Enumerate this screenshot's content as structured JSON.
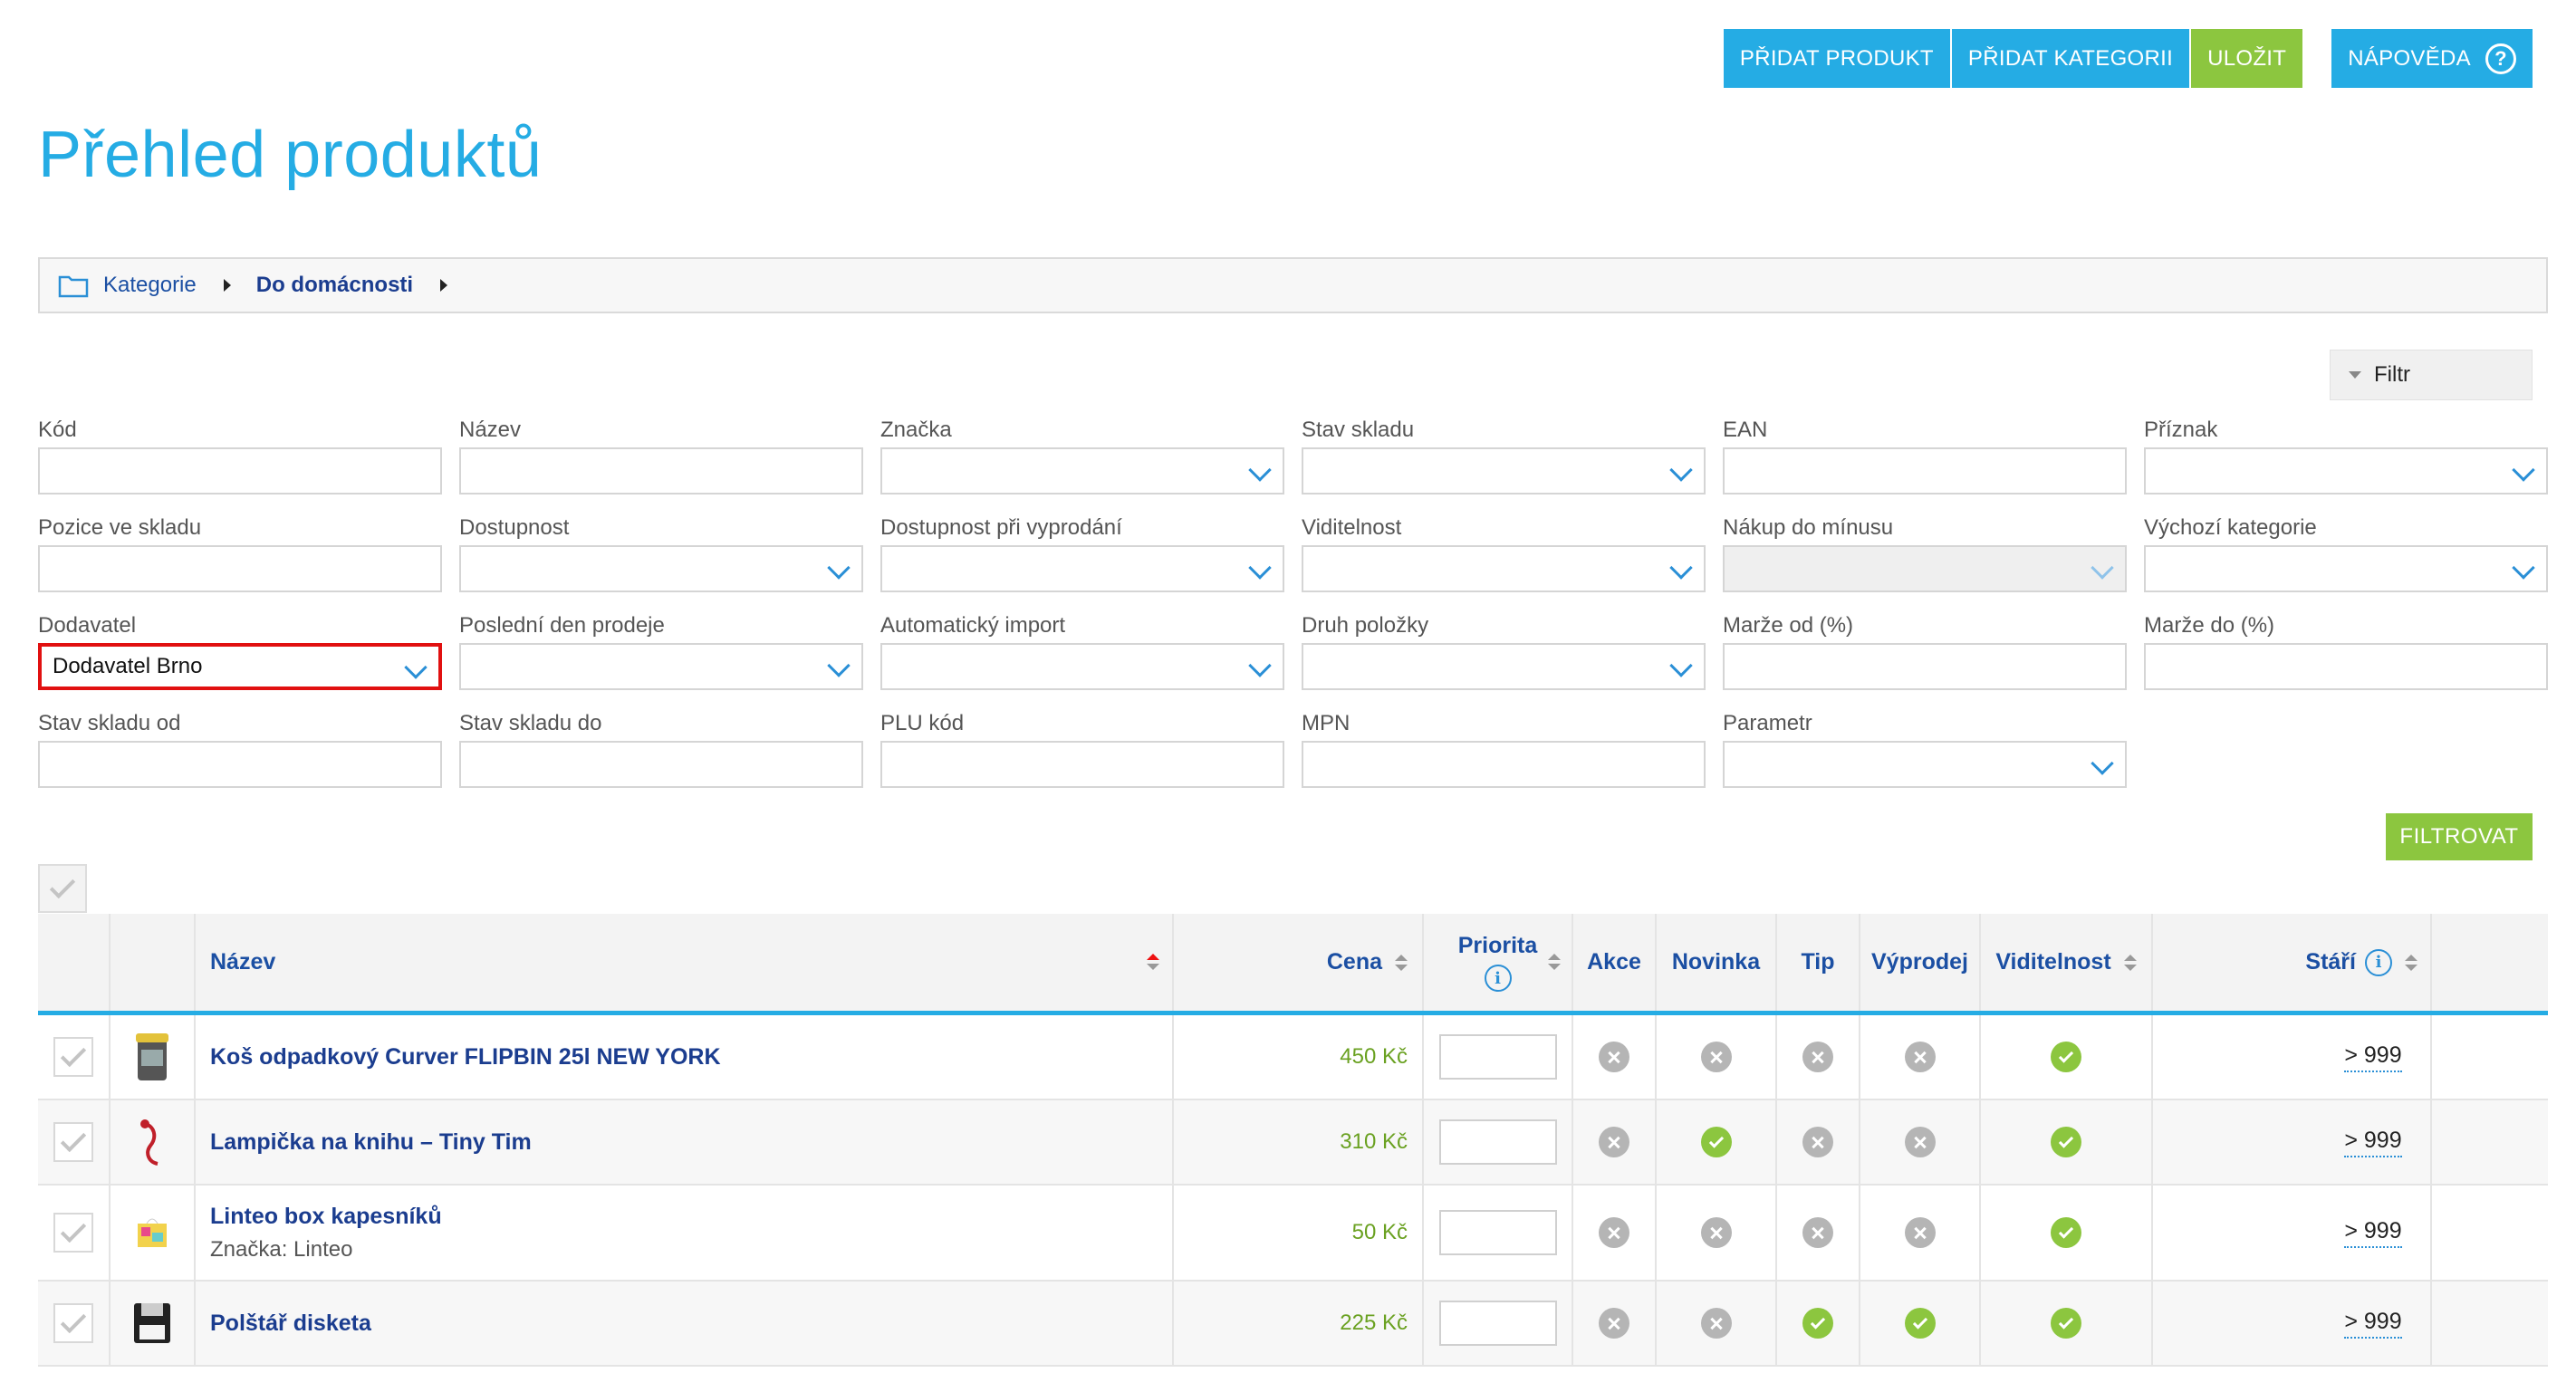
{
  "toolbar": {
    "add_product": "PŘIDAT PRODUKT",
    "add_category": "PŘIDAT KATEGORII",
    "save": "ULOŽIT",
    "help": "NÁPOVĚDA"
  },
  "colors": {
    "accent_blue": "#25ace4",
    "accent_green": "#8cc63f",
    "link_blue": "#1b4fa3",
    "highlight_red": "#e11010"
  },
  "page": {
    "title": "Přehled produktů"
  },
  "breadcrumb": {
    "root": "Kategorie",
    "current": "Do domácnosti"
  },
  "filter_toggle": "Filtr",
  "filters": [
    {
      "label": "Kód",
      "type": "text",
      "value": ""
    },
    {
      "label": "Název",
      "type": "text",
      "value": ""
    },
    {
      "label": "Značka",
      "type": "select",
      "value": ""
    },
    {
      "label": "Stav skladu",
      "type": "select",
      "value": ""
    },
    {
      "label": "EAN",
      "type": "text",
      "value": ""
    },
    {
      "label": "Příznak",
      "type": "select",
      "value": ""
    },
    {
      "label": "Pozice ve skladu",
      "type": "text",
      "value": ""
    },
    {
      "label": "Dostupnost",
      "type": "select",
      "value": ""
    },
    {
      "label": "Dostupnost při vyprodání",
      "type": "select",
      "value": ""
    },
    {
      "label": "Viditelnost",
      "type": "select",
      "value": ""
    },
    {
      "label": "Nákup do mínusu",
      "type": "select",
      "value": "",
      "disabled": true
    },
    {
      "label": "Výchozí kategorie",
      "type": "select",
      "value": ""
    },
    {
      "label": "Dodavatel",
      "type": "select",
      "value": "Dodavatel Brno",
      "highlighted": true
    },
    {
      "label": "Poslední den prodeje",
      "type": "select",
      "value": ""
    },
    {
      "label": "Automatický import",
      "type": "select",
      "value": ""
    },
    {
      "label": "Druh položky",
      "type": "select",
      "value": ""
    },
    {
      "label": "Marže od (%)",
      "type": "text",
      "value": ""
    },
    {
      "label": "Marže do (%)",
      "type": "text",
      "value": ""
    },
    {
      "label": "Stav skladu od",
      "type": "text",
      "value": ""
    },
    {
      "label": "Stav skladu do",
      "type": "text",
      "value": ""
    },
    {
      "label": "PLU kód",
      "type": "text",
      "value": ""
    },
    {
      "label": "MPN",
      "type": "text",
      "value": ""
    },
    {
      "label": "Parametr",
      "type": "select",
      "value": ""
    }
  ],
  "filter_button": "FILTROVAT",
  "table": {
    "columns": {
      "name": "Název",
      "price": "Cena",
      "priority": "Priorita",
      "akce": "Akce",
      "novinka": "Novinka",
      "tip": "Tip",
      "vyprodej": "Výprodej",
      "viditelnost": "Viditelnost",
      "stari": "Stáří"
    },
    "rows": [
      {
        "name": "Koš odpadkový Curver FLIPBIN 25l NEW YORK",
        "brand": "",
        "price": "450 Kč",
        "priority": "",
        "akce": false,
        "novinka": false,
        "tip": false,
        "vyprodej": false,
        "viditelnost": true,
        "stari": "> 999",
        "thumb": "trash-bin"
      },
      {
        "name": "Lampička na knihu – Tiny Tim",
        "brand": "",
        "price": "310 Kč",
        "priority": "",
        "akce": false,
        "novinka": true,
        "tip": false,
        "vyprodej": false,
        "viditelnost": true,
        "stari": "> 999",
        "thumb": "book-lamp"
      },
      {
        "name": "Linteo box kapesníků",
        "brand": "Značka: Linteo",
        "price": "50 Kč",
        "priority": "",
        "akce": false,
        "novinka": false,
        "tip": false,
        "vyprodej": false,
        "viditelnost": true,
        "stari": "> 999",
        "thumb": "tissue-box"
      },
      {
        "name": "Polštář disketa",
        "brand": "",
        "price": "225 Kč",
        "priority": "",
        "akce": false,
        "novinka": false,
        "tip": true,
        "vyprodej": true,
        "viditelnost": true,
        "stari": "> 999",
        "thumb": "floppy-pillow"
      }
    ]
  }
}
